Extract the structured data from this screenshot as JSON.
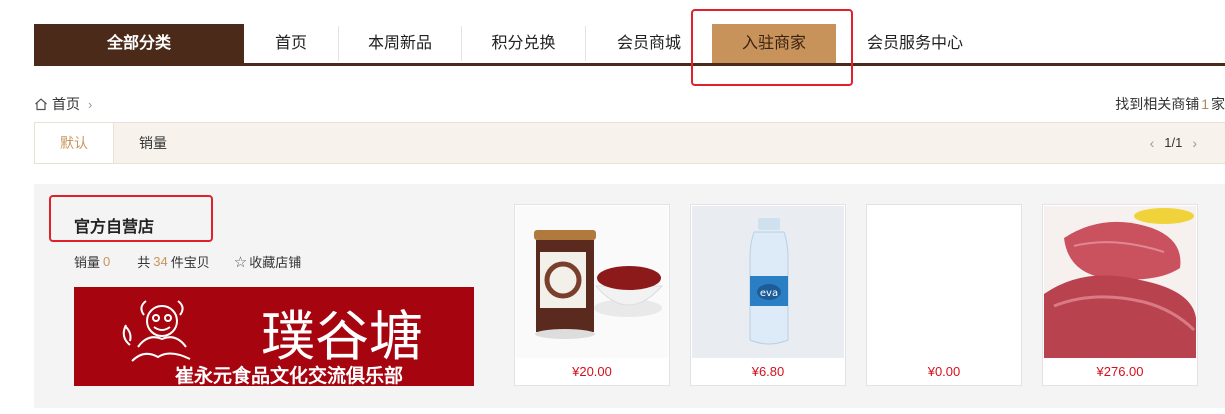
{
  "nav": {
    "all_categories": "全部分类",
    "items": [
      {
        "label": "首页"
      },
      {
        "label": "本周新品"
      },
      {
        "label": "积分兑换"
      },
      {
        "label": "会员商城"
      },
      {
        "label": "入驻商家"
      },
      {
        "label": "会员服务中心"
      }
    ],
    "active": "入驻商家"
  },
  "breadcrumb": {
    "home": "首页"
  },
  "results": {
    "prefix": "找到相关商铺",
    "count": "1",
    "suffix": "家"
  },
  "sort": {
    "default": "默认",
    "sales": "销量"
  },
  "pager": {
    "text": "1/1"
  },
  "store": {
    "name": "官方自营店",
    "sales_label": "销量",
    "sales_value": "0",
    "total_prefix": "共",
    "total_count": "34",
    "total_suffix": "件宝贝",
    "favorite_label": "收藏店铺",
    "banner_title": "璞谷塘",
    "banner_subtitle": "崔永元食品文化交流俱乐部",
    "products": [
      {
        "price": "¥20.00"
      },
      {
        "price": "¥6.80"
      },
      {
        "price": "¥0.00"
      },
      {
        "price": "¥276.00"
      }
    ]
  },
  "colors": {
    "brand_dark": "#4b2a19",
    "accent": "#c8935a",
    "price": "#d4101e",
    "highlight": "#e0212b"
  }
}
